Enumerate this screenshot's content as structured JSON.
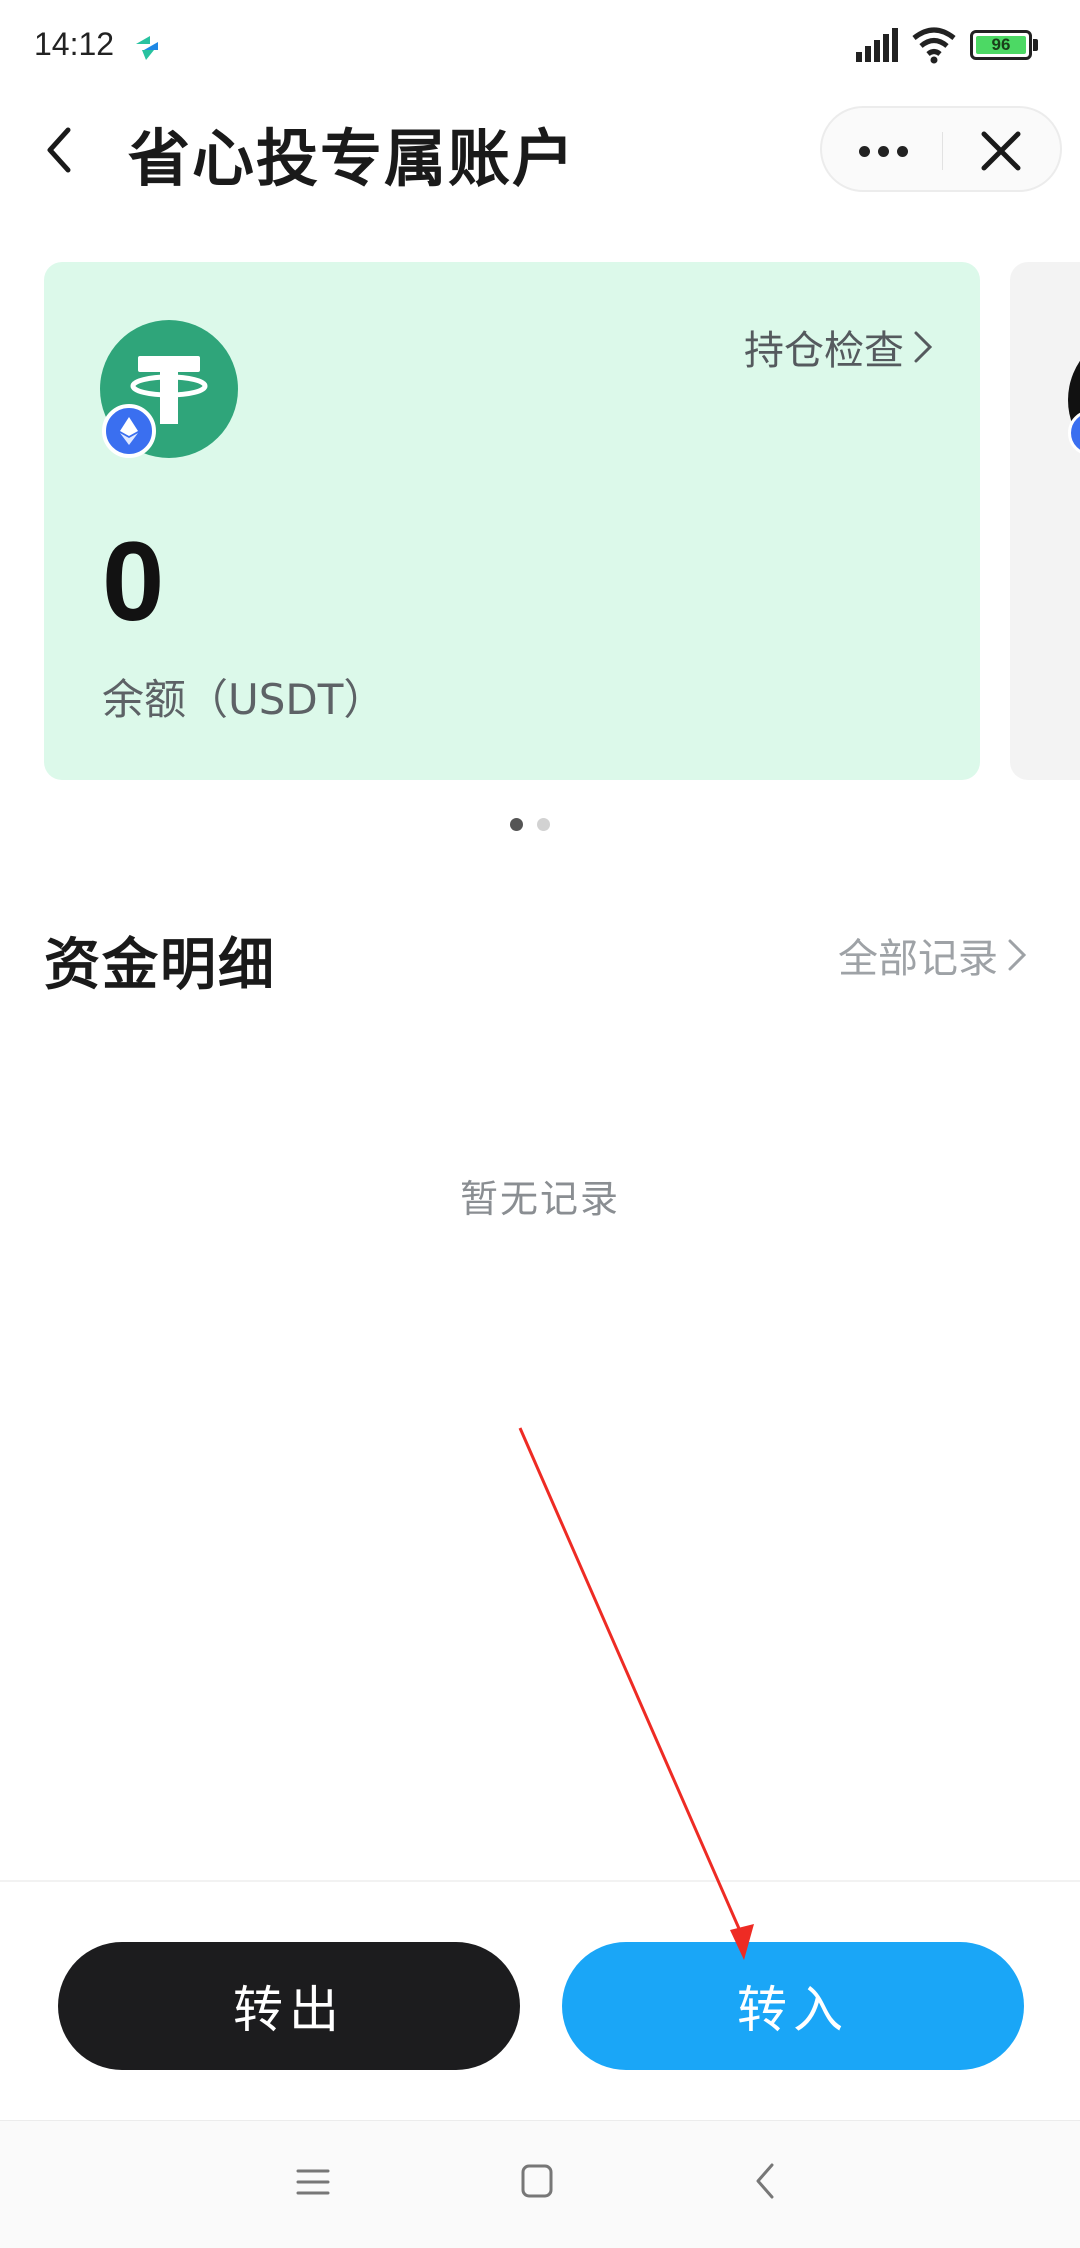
{
  "status_bar": {
    "time": "14:12",
    "battery_level": "96",
    "icons": [
      "app-notification-icon",
      "signal-icon",
      "wifi-icon",
      "battery-icon"
    ]
  },
  "header": {
    "title": "省心投专属账户",
    "icons": [
      "back-arrow-icon",
      "more-icon",
      "close-icon"
    ]
  },
  "account_card": {
    "holdings_check_label": "持仓检查",
    "balance": "0",
    "balance_label": "余额（USDT）",
    "icons": [
      "tether-usdt-icon",
      "ethereum-icon",
      "chevron-right-icon"
    ],
    "colors": {
      "card_bg": "#dcf9ea",
      "coin": "#2fa57a",
      "badge": "#3a6ff0"
    }
  },
  "pager": {
    "active_index": 0,
    "count": 2
  },
  "section": {
    "title": "资金明细",
    "all_records_label": "全部记录",
    "empty_text": "暂无记录"
  },
  "actions": {
    "transfer_out_label": "转出",
    "transfer_in_label": "转入",
    "colors": {
      "transfer_out": "#1c1c1e",
      "transfer_in": "#1aa6f7",
      "annotation_arrow": "#ee2b24"
    }
  },
  "nav_bar": {
    "icons": [
      "menu-icon",
      "home-icon",
      "back-icon"
    ]
  }
}
